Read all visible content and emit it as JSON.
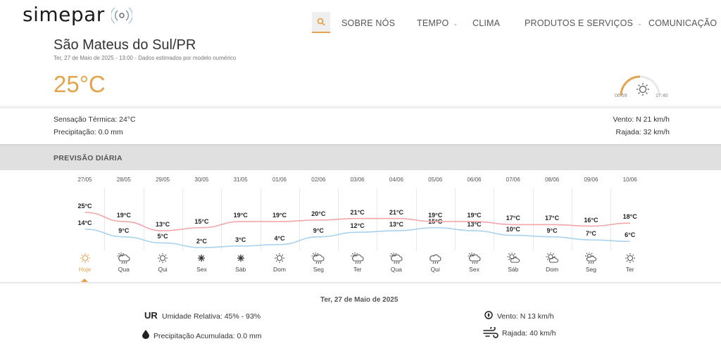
{
  "brand": {
    "name": "simepar"
  },
  "nav": {
    "items": [
      {
        "label": "SOBRE NÓS",
        "dropdown": false
      },
      {
        "label": "TEMPO",
        "dropdown": true
      },
      {
        "label": "CLIMA",
        "dropdown": false
      },
      {
        "label": "PRODUTOS E SERVIÇOS",
        "dropdown": true
      },
      {
        "label": "COMUNICAÇÃO",
        "dropdown": true
      }
    ]
  },
  "location": {
    "city": "São Mateus do Sul/PR",
    "subtitle": "Ter, 27 de Maio de 2025 - 13:00 - Dados estimados por modelo numérico",
    "temperature": "25°C"
  },
  "sun": {
    "sunrise": "06:59",
    "sunset": "17:40",
    "icon": "sun-icon"
  },
  "current": {
    "sensacao": "Sensação Térmica: 24°C",
    "precipitacao": "Precipitação: 0.0 mm",
    "vento": "Vento: N 21 km/h",
    "rajada": "Rajada: 32 km/h"
  },
  "forecast_section": {
    "title": "PREVISÃO DIÁRIA"
  },
  "forecast": [
    {
      "date": "27/05",
      "max": "25°C",
      "min": "14°C",
      "day": "Hoje",
      "icon": "sun"
    },
    {
      "date": "28/05",
      "max": "19°C",
      "min": "9°C",
      "day": "Qua",
      "icon": "cloud-rain-sun"
    },
    {
      "date": "29/05",
      "max": "13°C",
      "min": "5°C",
      "day": "Qui",
      "icon": "sun"
    },
    {
      "date": "30/05",
      "max": "15°C",
      "min": "2°C",
      "day": "Sex",
      "icon": "sun-bright"
    },
    {
      "date": "31/05",
      "max": "19°C",
      "min": "3°C",
      "day": "Sáb",
      "icon": "sun-bright"
    },
    {
      "date": "01/06",
      "max": "19°C",
      "min": "4°C",
      "day": "Dom",
      "icon": "sun"
    },
    {
      "date": "02/06",
      "max": "20°C",
      "min": "9°C",
      "day": "Seg",
      "icon": "cloud-rain-sun"
    },
    {
      "date": "03/06",
      "max": "21°C",
      "min": "12°C",
      "day": "Ter",
      "icon": "cloud-rain-sun"
    },
    {
      "date": "04/06",
      "max": "21°C",
      "min": "13°C",
      "day": "Qua",
      "icon": "cloud-rain-sun"
    },
    {
      "date": "05/06",
      "max": "19°C",
      "min": "15°C",
      "day": "Qui",
      "icon": "cloud-rain"
    },
    {
      "date": "06/06",
      "max": "19°C",
      "min": "13°C",
      "day": "Sex",
      "icon": "cloud-rain-sun"
    },
    {
      "date": "07/06",
      "max": "17°C",
      "min": "10°C",
      "day": "Sáb",
      "icon": "sun-cloud"
    },
    {
      "date": "08/06",
      "max": "17°C",
      "min": "9°C",
      "day": "Dom",
      "icon": "sun-cloud"
    },
    {
      "date": "09/06",
      "max": "16°C",
      "min": "7°C",
      "day": "Seg",
      "icon": "sun-cloud-rain"
    },
    {
      "date": "10/06",
      "max": "18°C",
      "min": "6°C",
      "day": "Ter",
      "icon": "sun"
    }
  ],
  "chart_data": {
    "type": "line",
    "x": [
      "27/05",
      "28/05",
      "29/05",
      "30/05",
      "31/05",
      "01/06",
      "02/06",
      "03/06",
      "04/06",
      "05/06",
      "06/06",
      "07/06",
      "08/06",
      "09/06",
      "10/06"
    ],
    "series": [
      {
        "values": [
          25,
          19,
          13,
          15,
          19,
          19,
          20,
          21,
          21,
          19,
          19,
          17,
          17,
          16,
          18
        ],
        "color": "#f2a6aa"
      },
      {
        "values": [
          14,
          9,
          5,
          2,
          3,
          4,
          9,
          12,
          13,
          15,
          13,
          10,
          9,
          7,
          6
        ],
        "color": "#a9d2ef"
      }
    ],
    "ylim": [
      2,
      25
    ]
  },
  "detail": {
    "date": "Ter, 27 de Maio de 2025",
    "ur_label": "UR",
    "umidade": "Umidade Relativa: 45% - 93%",
    "precipitacao": "Precipitação Acumulada: 0.0 mm",
    "vento": "Vento: N 13 km/h",
    "rajada": "Rajada: 40 km/h"
  },
  "colors": {
    "accent": "#e3a44b",
    "max_line": "#f2a6aa",
    "min_line": "#a9d2ef"
  }
}
